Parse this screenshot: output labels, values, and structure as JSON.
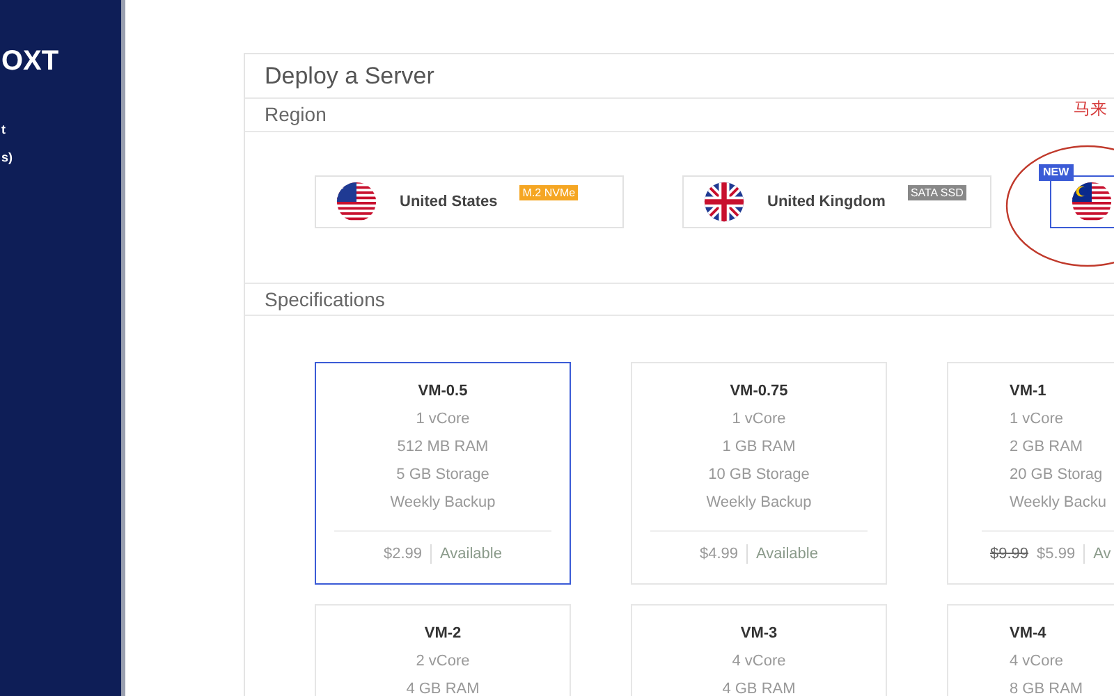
{
  "sidebar": {
    "logo": "OXT",
    "items": [
      "t",
      "s)"
    ]
  },
  "panel": {
    "title": "Deploy a Server",
    "region_heading": "Region",
    "annotation": "马来",
    "specs_heading": "Specifications"
  },
  "regions": [
    {
      "name": "United States",
      "kind": "us",
      "badge": "M.2 NVMe",
      "color": "#f5a623",
      "selected": false
    },
    {
      "name": "United Kingdom",
      "kind": "uk",
      "badge": "SATA SSD",
      "color": "#888888",
      "selected": false
    },
    {
      "kind": "my",
      "new_tag": "NEW",
      "selected": true
    }
  ],
  "plans": [
    {
      "name": "VM-0.5",
      "specs": [
        "1 vCore",
        "512 MB RAM",
        "5 GB Storage",
        "Weekly Backup"
      ],
      "price": "$2.99",
      "status": "Available",
      "selected": true
    },
    {
      "name": "VM-0.75",
      "specs": [
        "1 vCore",
        "1 GB RAM",
        "10 GB Storage",
        "Weekly Backup"
      ],
      "price": "$4.99",
      "status": "Available",
      "selected": false
    },
    {
      "name": "VM-1",
      "specs": [
        "1 vCore",
        "2 GB RAM",
        "20 GB Storag",
        "Weekly Backu"
      ],
      "old_price": "$9.99",
      "price": "$5.99",
      "status": "Av",
      "selected": false
    },
    {
      "name": "VM-2",
      "specs": [
        "2 vCore",
        "4 GB RAM"
      ],
      "selected": false
    },
    {
      "name": "VM-3",
      "specs": [
        "4 vCore",
        "4 GB RAM"
      ],
      "selected": false
    },
    {
      "name": "VM-4",
      "specs": [
        "4 vCore",
        "8 GB RAM"
      ],
      "selected": false
    }
  ]
}
